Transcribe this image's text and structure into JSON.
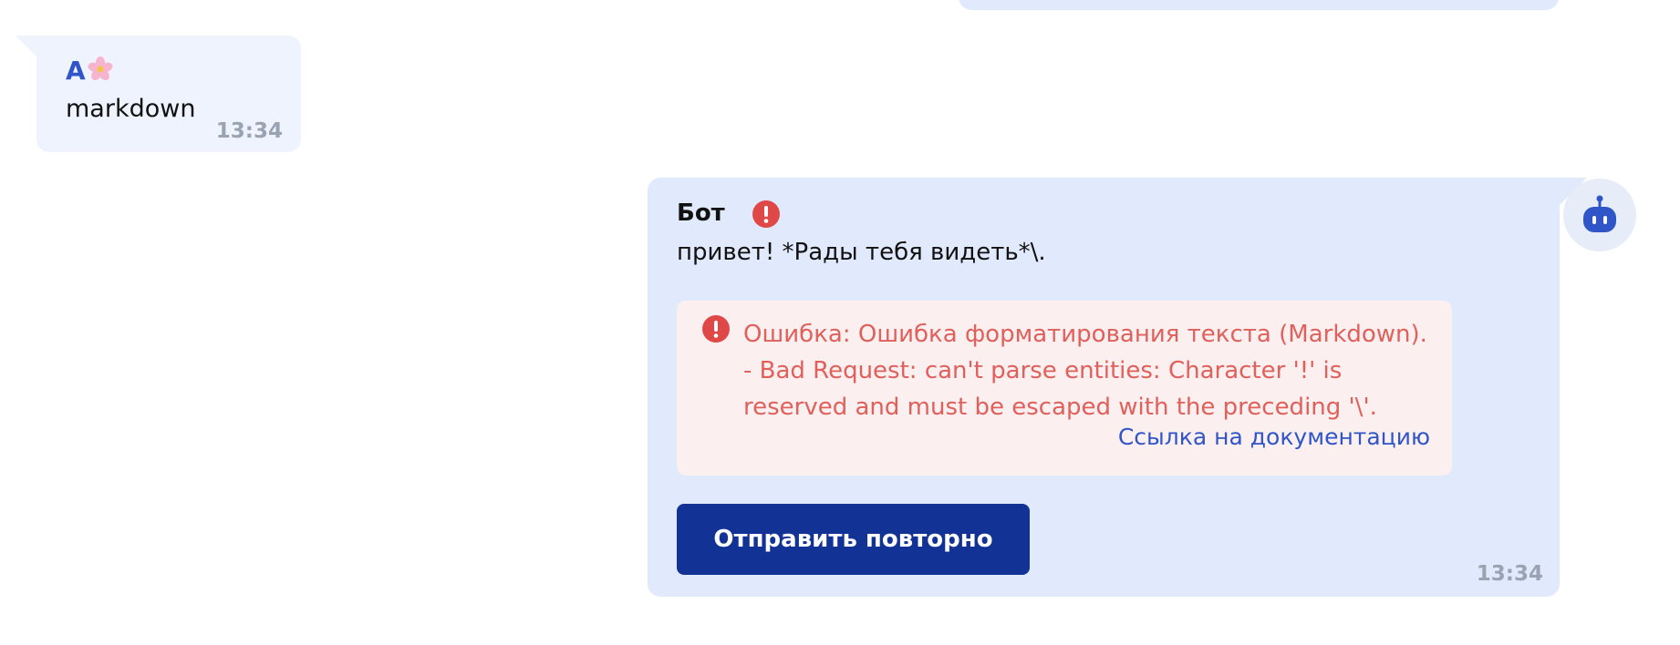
{
  "incoming_message": {
    "sender": "А",
    "sender_icon": "cherry-blossom-icon",
    "text": "markdown",
    "time": "13:34"
  },
  "bot_message": {
    "sender": "Бот",
    "status_icon": "alert-icon",
    "text": "привет! *Рады тебя видеть*\\.",
    "error": {
      "icon": "alert-icon",
      "text": "Ошибка: Ошибка форматирования текста (Markdown). - Bad Request: can't parse entities: Character '!' is reserved and must be escaped with the preceding '\\'.",
      "doc_link": "Ссылка на документацию"
    },
    "resend_label": "Отправить повторно",
    "time": "13:34",
    "avatar_icon": "robot-icon"
  },
  "colors": {
    "accent": "#133296",
    "link": "#2f55c9",
    "error_text": "#e0605c",
    "error_bg": "#fbefef",
    "error_icon": "#e04848",
    "bot_bubble": "#e1eafc",
    "user_bubble": "#eef3fd"
  }
}
